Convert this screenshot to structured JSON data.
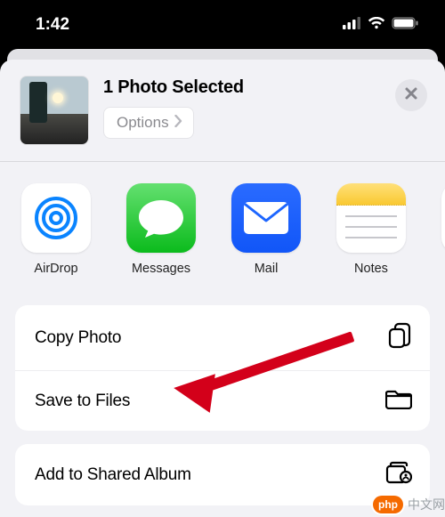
{
  "status": {
    "time": "1:42"
  },
  "header": {
    "title": "1 Photo Selected",
    "options_label": "Options"
  },
  "apps": [
    {
      "label": "AirDrop"
    },
    {
      "label": "Messages"
    },
    {
      "label": "Mail"
    },
    {
      "label": "Notes"
    }
  ],
  "actions_group1": [
    {
      "label": "Copy Photo"
    },
    {
      "label": "Save to Files"
    }
  ],
  "actions_group2": [
    {
      "label": "Add to Shared Album"
    }
  ],
  "watermark": {
    "badge": "php",
    "text": "中文网"
  }
}
